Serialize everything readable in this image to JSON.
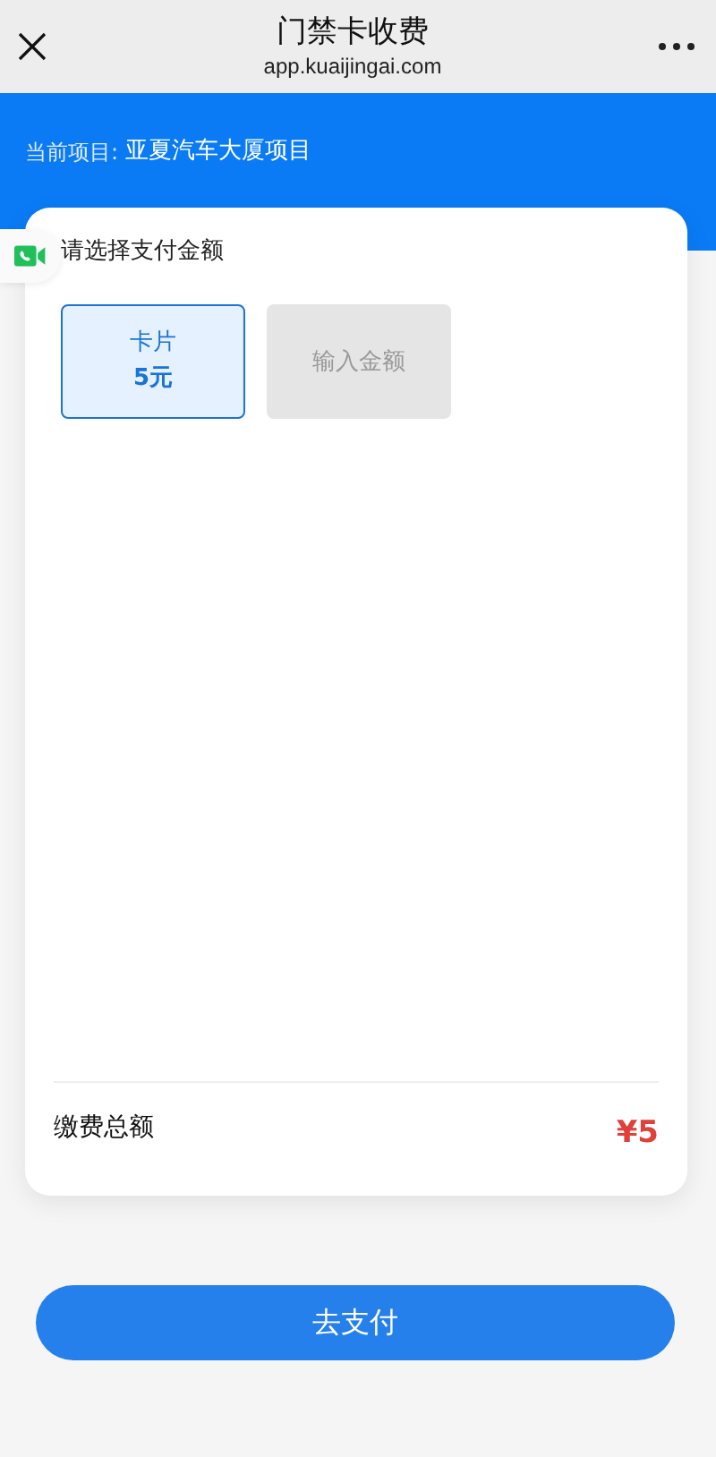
{
  "window": {
    "title": "门禁卡收费",
    "url": "app.kuaijingai.com"
  },
  "project": {
    "label": "当前项目:",
    "name": "亚夏汽车大厦项目"
  },
  "section_title": "请选择支付金额",
  "options": [
    {
      "kind": "preset",
      "lines": [
        "卡片",
        "5元"
      ],
      "selected": true
    },
    {
      "kind": "input",
      "placeholder": "输入金额",
      "selected": false
    }
  ],
  "total": {
    "label": "缴费总额",
    "amount": "¥5"
  },
  "pay_button": "去支付"
}
